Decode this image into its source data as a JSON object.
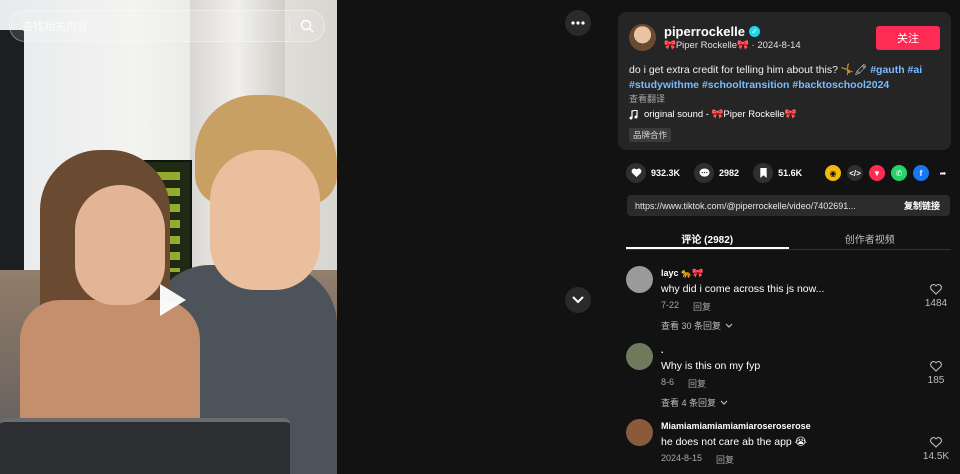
{
  "search": {
    "placeholder": "查找相关内容"
  },
  "author": {
    "username": "piperrockelle",
    "display_name": "🎀Piper Rockelle🎀",
    "date": "2024-8-14",
    "follow_label": "关注"
  },
  "post": {
    "caption": "do i get extra credit for telling him about this? 🤸🖍",
    "hashtags": [
      "#gauth",
      "#ai",
      "#studywithme",
      "#schooltransition",
      "#backtoschool2024"
    ],
    "translate_label": "查看翻译",
    "sound": "original sound - 🎀Piper Rockelle🎀",
    "brand_label": "品牌合作"
  },
  "stats": {
    "likes": "932.3K",
    "comments": "2982",
    "saves": "51.6K"
  },
  "link": {
    "url": "https://www.tiktok.com/@piperrockelle/video/7402691...",
    "copy_label": "复制链接"
  },
  "tabs": [
    {
      "label": "评论 (2982)"
    },
    {
      "label": "创作者视频"
    }
  ],
  "comments": [
    {
      "name": "layc 🐆🎀",
      "text": "why did i come across this js now...",
      "date": "7-22",
      "reply": "回复",
      "more": "查看 30 条回复",
      "likes": "1484",
      "avatar_color": "#9a9a9a"
    },
    {
      "name": ".",
      "text": "Why is this on my fyp",
      "date": "8-6",
      "reply": "回复",
      "more": "查看 4 条回复",
      "likes": "185",
      "avatar_color": "#6f7a5a"
    },
    {
      "name": "Miamiamiamiamiamiaroseroserose",
      "text": "he does not care ab the app 😭",
      "date": "2024-8-15",
      "reply": "回复",
      "more": "",
      "likes": "14.5K",
      "avatar_color": "#8a5a3a"
    }
  ],
  "colors": {
    "accent": "#fe2c55",
    "hashtag": "#79bcff",
    "verified": "#20d5ec"
  }
}
